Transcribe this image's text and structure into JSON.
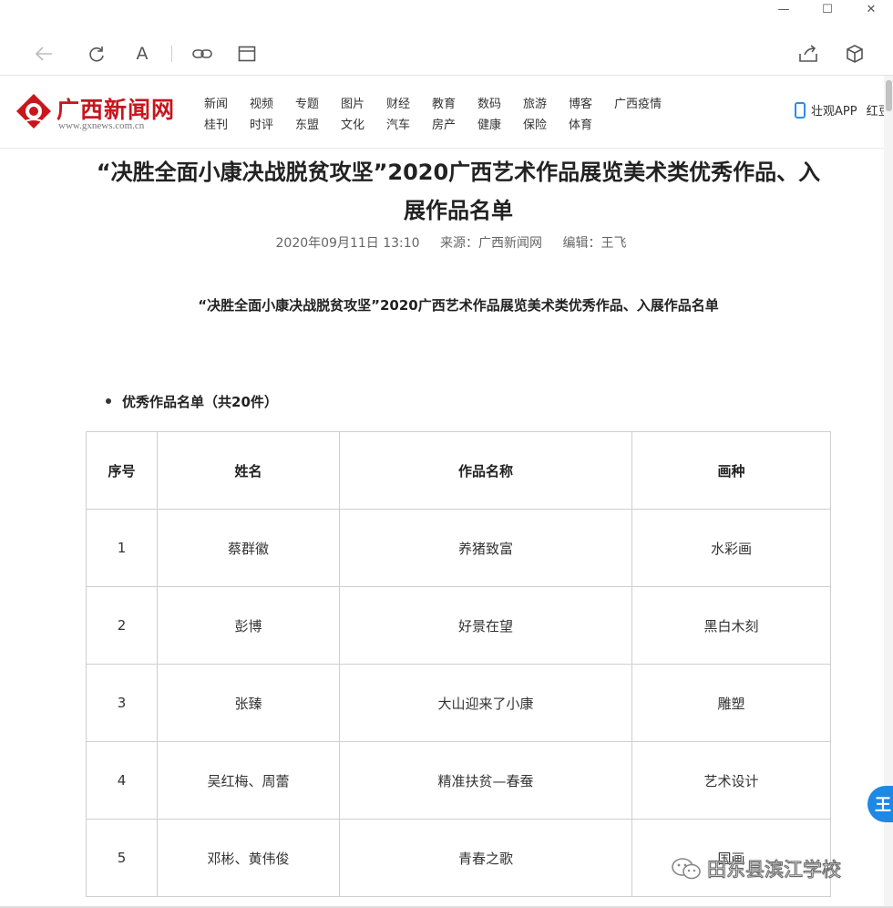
{
  "window": {
    "minimize": "—",
    "maximize": "☐",
    "close": "✕"
  },
  "toolbar": {
    "icons": [
      "back-arrow-icon",
      "refresh-icon",
      "font-icon",
      "link-icon",
      "window-icon",
      "share-icon",
      "cube-icon"
    ],
    "reader_label": "A"
  },
  "site": {
    "logo_text": "广西新闻网",
    "logo_url": "www.gxnews.com.cn",
    "nav_row1": [
      "新闻",
      "视频",
      "专题",
      "图片",
      "财经",
      "教育",
      "数码",
      "旅游",
      "博客",
      "广西疫情"
    ],
    "nav_row2": [
      "桂刊",
      "时评",
      "东盟",
      "文化",
      "汽车",
      "房产",
      "健康",
      "保险",
      "体育"
    ],
    "app_label": "壮观APP",
    "app_extra": "红豆"
  },
  "article": {
    "title_line1": "“决胜全面小康决战脱贫攻坚”2020广西艺术作品展览美术类优秀作品、入",
    "title_line2": "展作品名单",
    "date": "2020年09月11日 13:10",
    "source": "来源：广西新闻网",
    "editor": "编辑：王飞",
    "subtitle": "“决胜全面小康决战脱贫攻坚”2020广西艺术作品展览美术类优秀作品、入展作品名单",
    "section_heading": "优秀作品名单（共20件）"
  },
  "table": {
    "headers": [
      "序号",
      "姓名",
      "作品名称",
      "画种"
    ],
    "rows": [
      [
        "1",
        "蔡群徽",
        "养猪致富",
        "水彩画"
      ],
      [
        "2",
        "彭博",
        "好景在望",
        "黑白木刻"
      ],
      [
        "3",
        "张臻",
        "大山迎来了小康",
        "雕塑"
      ],
      [
        "4",
        "吴红梅、周蕾",
        "精准扶贫—春蚕",
        "艺术设计"
      ],
      [
        "5",
        "邓彬、黄伟俊",
        "青春之歌",
        "国画"
      ]
    ]
  },
  "float_button": "王",
  "watermark": "田东县滨江学校",
  "colors": {
    "logo_red": "#c8161d",
    "app_blue": "#2a8ee5"
  }
}
